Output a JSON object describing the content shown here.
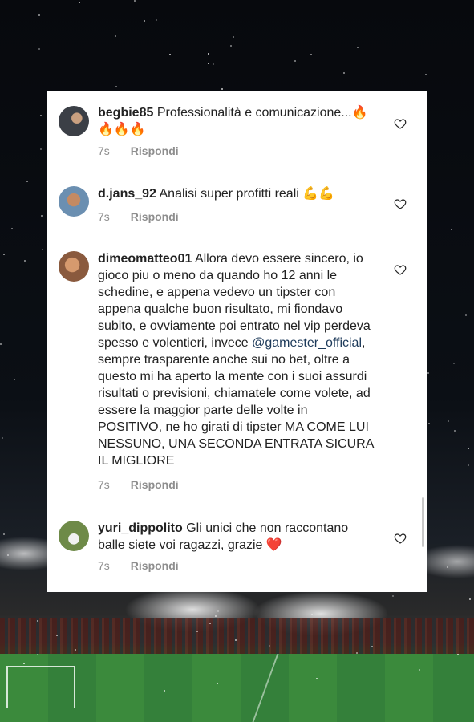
{
  "comments": [
    {
      "user": "begbie85",
      "text": "Professionalità e comunicazione...🔥🔥🔥🔥",
      "time": "7s",
      "reply": "Rispondi",
      "avatar": "profile-photo"
    },
    {
      "user": "d.jans_92",
      "text": "Analisi super profitti reali 💪💪",
      "time": "7s",
      "reply": "Rispondi",
      "avatar": "profile-photo"
    },
    {
      "user": "dimeomatteo01",
      "text_before": "Allora devo essere sincero, io gioco piu o meno da quando ho 12 anni le schedine, e appena vedevo un tipster con appena qualche buon risultato, mi fiondavo subito, e ovviamente poi entrato nel vip perdeva spesso e volentieri, invece ",
      "mention": "@gamester_official",
      "text_after": ", sempre trasparente anche sui no bet, oltre a questo mi ha aperto la mente con i suoi assurdi risultati o previsioni, chiamatele come volete, ad essere la maggior parte delle volte in POSITIVO, ne ho girati di tipster MA COME LUI NESSUNO, UNA SECONDA ENTRATA SICURA IL MIGLIORE",
      "time": "7s",
      "reply": "Rispondi",
      "avatar": "profile-photo"
    },
    {
      "user": "yuri_dippolito",
      "text": "Gli unici che non raccontano balle siete voi ragazzi, grazie ❤️",
      "time": "7s",
      "reply": "Rispondi",
      "avatar": "profile-photo"
    }
  ],
  "icons": {
    "like": "heart-outline-icon"
  },
  "colors": {
    "card": "#ffffff",
    "meta": "#8e8e8e",
    "mention": "#1d3a5a"
  }
}
